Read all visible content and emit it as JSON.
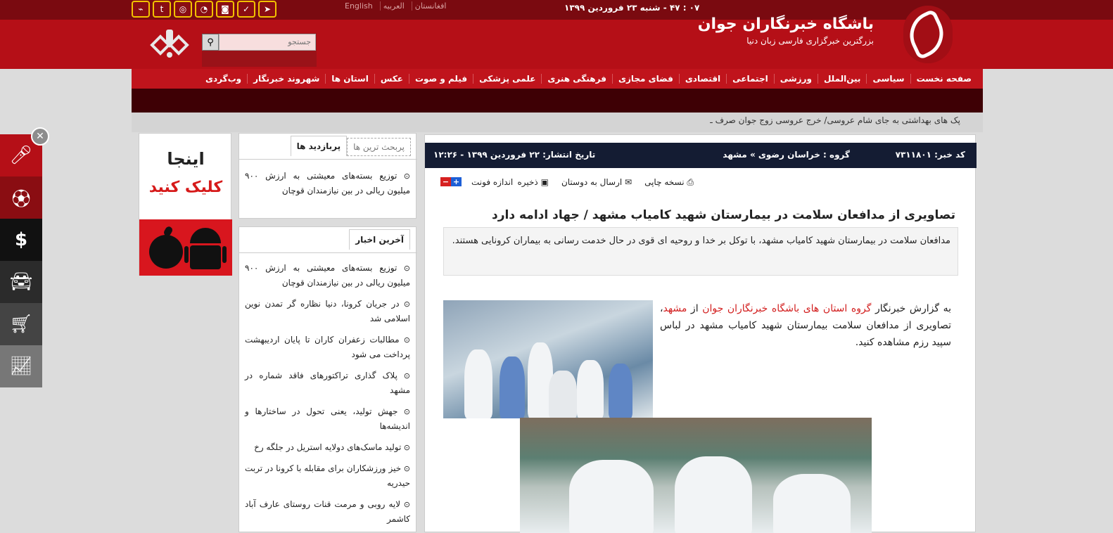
{
  "topbar": {
    "social_icons": [
      "rss-icon",
      "twitter-icon",
      "instagram-icon",
      "soroush-icon",
      "android-icon",
      "check-icon",
      "telegram-icon"
    ],
    "languages": [
      "English",
      "العربیه",
      "افغانستان"
    ],
    "datetime": "۰۷ : ۴۷ - شنبه ۲۳ فروردین ۱۳۹۹"
  },
  "brand": {
    "title": "باشگاه خبرنگاران جوان",
    "tagline": "بزرگترین خبرگزاری فارسی زبان دنیا"
  },
  "search": {
    "placeholder": "جستجو"
  },
  "nav": [
    "صفحه نخست",
    "سیاسی",
    "بین‌الملل",
    "ورزشی",
    "اجتماعی",
    "اقتصادی",
    "فضای مجازی",
    "فرهنگی هنری",
    "علمی پزشکی",
    "فیلم و صوت",
    "عکس",
    "استان ها",
    "شهروند خبرنگار",
    "وب‌گردی"
  ],
  "ticker": "پک های بهداشتی به جای شام عروسی/ خرج عروسی زوج جوان صرف ـ",
  "article": {
    "code": "کد خبر: ۷۳۱۱۸۰۱",
    "group": "گروه : خراسان رضوی » مشهد",
    "date": "تاریخ انتشار: ۲۲ فروردین ۱۳۹۹ - ۱۲:۲۶",
    "tools": {
      "save": "ذخیره",
      "send": "ارسال به دوستان",
      "print": "نسخه چاپی",
      "font": "اندازه فونت"
    },
    "title": "تصاویری از مدافعان سلامت در بیمارستان شهید کامیاب مشهد / جهاد ادامه دارد",
    "lead": "مدافعان سلامت در بیمارستان شهید کامیاب مشهد، با توکل بر خدا و روحیه ای قوی در حال خدمت رسانی به بیماران کرونایی هستند.",
    "body_prefix": "به گزارش خبرنگار ",
    "body_link1": "گروه استان های باشگاه خبرنگاران جوان",
    "body_mid": " از ",
    "body_link2": "مشهد",
    "body_suffix": "، تصاویری از مدافعان سلامت بیمارستان شهید کامیاب مشهد در لباس سپید رزم مشاهده کنید."
  },
  "most_visited": {
    "tab_active": "پربازدید ها",
    "tab_other": "پربحث ترین ها",
    "items": [
      "توزیع بسته‌های معیشتی به ارزش ۹۰۰ میلیون ریالی در بین نیازمندان قوچان"
    ]
  },
  "latest": {
    "tab": "آخرین اخبار",
    "items": [
      "توزیع بسته‌های معیشتی به ارزش ۹۰۰ میلیون ریالی در بین نیازمندان قوچان",
      "در جریان کرونا، دنیا نظاره گر تمدن نوین اسلامی شد",
      "مطالبات زعفران کاران تا پایان اردیبهشت پرداخت می شود",
      "پلاک گذاری تراکتورهای فاقد شماره در مشهد",
      "جهش تولید، یعنی تحول در ساختارها و اندیشه‌ها",
      "تولید ماسک‌های دولایه استریل در جلگه رخ",
      "خیز ورزشکاران برای مقابله با کرونا در تربت حیدریه",
      "لایه روبی و مرمت قنات روستای عارف آباد کاشمر"
    ]
  },
  "ad": {
    "line1": "اینجا",
    "line2": "کلیک کنید"
  },
  "side_icons": [
    "microphone-icon",
    "football-icon",
    "dollar-icon",
    "car-icon",
    "cart-icon",
    "chart-icon"
  ],
  "colors": {
    "brand_red": "#b50f17",
    "dark_red": "#3e0005",
    "navy": "#141c33",
    "link_red": "#d21d1d"
  }
}
